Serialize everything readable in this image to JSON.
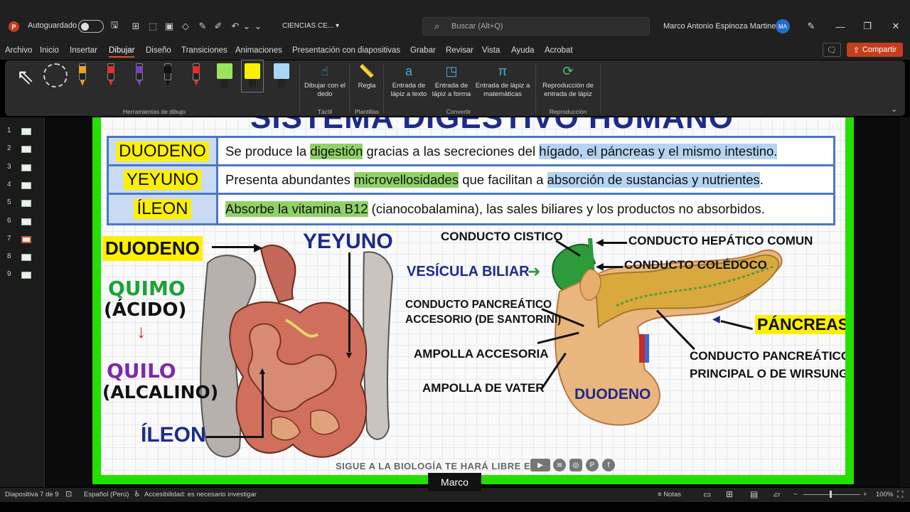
{
  "titlebar": {
    "autosave_label": "Autoguardado",
    "document_name": "CIENCIAS CE...",
    "search_placeholder": "Buscar (Alt+Q)",
    "user_name": "Marco Antonio Espinoza Martinez",
    "user_initials": "MA"
  },
  "menu": {
    "tabs": [
      "Archivo",
      "Inicio",
      "Insertar",
      "Dibujar",
      "Diseño",
      "Transiciones",
      "Animaciones",
      "Presentación con diapositivas",
      "Grabar",
      "Revisar",
      "Vista",
      "Ayuda",
      "Acrobat"
    ],
    "active_tab": "Dibujar",
    "share_label": "Compartir"
  },
  "ribbon": {
    "group_drawing_tools": "Herramientas de dibujo",
    "draw_with_finger": "Dibujar con el dedo",
    "group_touch": "Táctil",
    "ruler": "Regla",
    "group_templates": "Plantillas",
    "ink_to_text": "Entrada de lápiz a texto",
    "ink_to_shape": "Entrada de lápiz a forma",
    "ink_to_math": "Entrada de lápiz a matemáticas",
    "group_convert": "Convertir",
    "ink_replay": "Reproducción de entrada de lápiz",
    "group_replay": "Reproducción",
    "pen_colors": [
      "#f0a020",
      "#e03030",
      "#7b3fbf",
      "#111111",
      "#e03030"
    ],
    "highlighter_colors": [
      "#9be35a",
      "#fcf000",
      "#a8d7f7"
    ]
  },
  "thumbnails": [
    "1",
    "2",
    "3",
    "4",
    "5",
    "6",
    "7",
    "8",
    "9"
  ],
  "active_slide": 7,
  "slide": {
    "title": "SISTEMA DIGESTIVO HUMANO",
    "table": [
      {
        "name": "DUODENO",
        "parts": [
          {
            "text": "Se produce la ",
            "hl": ""
          },
          {
            "text": "digestión",
            "hl": "green"
          },
          {
            "text": " gracias a las secreciones del ",
            "hl": ""
          },
          {
            "text": "hígado, el páncreas y el mismo intestino.",
            "hl": "blue"
          }
        ]
      },
      {
        "name": "YEYUNO",
        "parts": [
          {
            "text": "Presenta abundantes ",
            "hl": ""
          },
          {
            "text": "microvellosidades",
            "hl": "green"
          },
          {
            "text": " que facilitan a ",
            "hl": ""
          },
          {
            "text": "absorción de sustancias y nutrientes",
            "hl": "blue"
          },
          {
            "text": ".",
            "hl": ""
          }
        ]
      },
      {
        "name": "ÍLEON",
        "parts": [
          {
            "text": "Absorbe la vitamina B12",
            "hl": "green"
          },
          {
            "text": " (cianocobalamina), las sales biliares y los productos no absorbidos.",
            "hl": ""
          }
        ]
      }
    ],
    "left_labels": {
      "duodeno": "DUODENO",
      "yeyuno": "YEYUNO",
      "ileon": "ÍLEON",
      "quimo": "QUIMO",
      "acido": "(ÁCIDO)",
      "quilo": "QUILO",
      "alcalino": "(ALCALINO)"
    },
    "right_labels": {
      "conducto_cistico": "CONDUCTO CISTICO",
      "conducto_hepatico": "CONDUCTO HEPÁTICO COMUN",
      "vesicula": "VESÍCULA BILIAR",
      "conducto_coledoco": "CONDUCTO COLÉDOCO",
      "pancreatico_accesorio_1": "CONDUCTO PANCREÁTICO",
      "pancreatico_accesorio_2": "ACCESORIO (DE SANTORINI)",
      "pancreas": "PÁNCREAS",
      "ampolla_accesoria": "AMPOLLA ACCESORIA",
      "principal_1": "CONDUCTO PANCREÁTICO",
      "principal_2": "PRINCIPAL O DE WIRSUNG",
      "ampolla_vater": "AMPOLLA DE VATER",
      "duodeno": "DUODENO"
    },
    "footer": "SIGUE A LA BIOLOGÍA TE HARÁ LIBRE EN"
  },
  "statusbar": {
    "slide_counter": "Diapositiva 7 de 9",
    "language": "Español (Perú)",
    "accessibility": "Accesibilidad: es necesario investigar",
    "notes": "Notas",
    "zoom": "100%"
  },
  "caption": "Marco"
}
